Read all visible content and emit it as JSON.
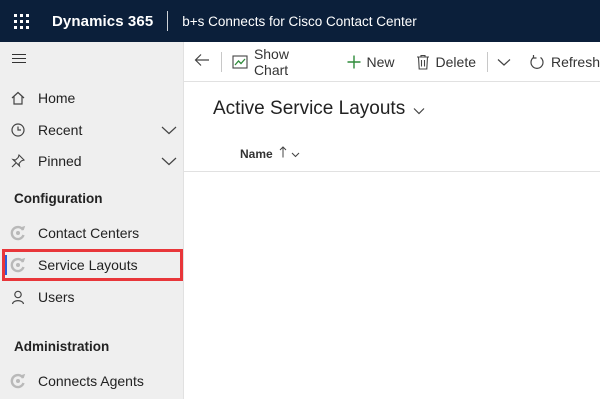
{
  "header": {
    "brand": "Dynamics 365",
    "app_name": "b+s Connects for Cisco Contact Center"
  },
  "sidebar": {
    "items": [
      {
        "label": "Home",
        "icon": "home-icon"
      },
      {
        "label": "Recent",
        "icon": "clock-icon"
      },
      {
        "label": "Pinned",
        "icon": "pin-icon"
      }
    ],
    "sections": [
      {
        "title": "Configuration",
        "items": [
          {
            "label": "Contact Centers",
            "icon": "entity-icon"
          },
          {
            "label": "Service Layouts",
            "icon": "entity-icon",
            "selected": true
          },
          {
            "label": "Users",
            "icon": "person-icon"
          }
        ]
      },
      {
        "title": "Administration",
        "items": [
          {
            "label": "Connects Agents",
            "icon": "entity-icon"
          }
        ]
      }
    ]
  },
  "commandbar": {
    "show_chart": "Show Chart",
    "new": "New",
    "delete": "Delete",
    "refresh": "Refresh"
  },
  "view": {
    "title": "Active Service Layouts",
    "columns": [
      {
        "label": "Name",
        "sort": "ascending"
      }
    ]
  },
  "colors": {
    "header_bg": "#0b1f3a",
    "sidebar_bg": "#efefef",
    "selected_indicator": "#2b5fd9",
    "highlight_border": "#e8363a",
    "new_icon": "#2e8b3a"
  }
}
